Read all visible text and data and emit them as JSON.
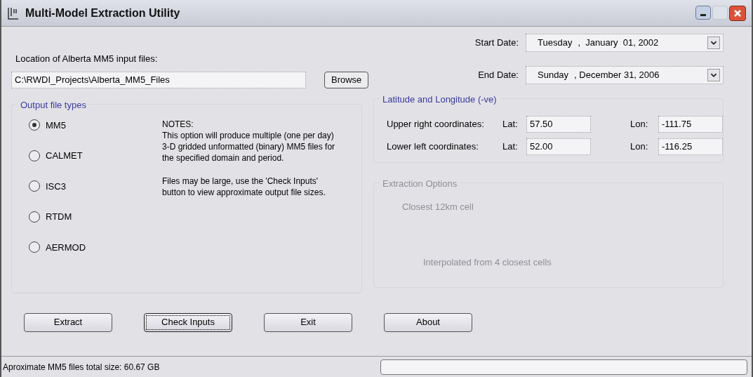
{
  "window": {
    "title": "Multi-Model Extraction Utility"
  },
  "input_location": {
    "label": "Location of Alberta MM5 input files:",
    "value": "C:\\RWDI_Projects\\Alberta_MM5_Files",
    "browse_button": "Browse"
  },
  "dates": [
    {
      "label": "Start Date:",
      "weekday": "Tuesday",
      "date": ",  January  01, 2002"
    },
    {
      "label": "End Date:",
      "weekday": "Sunday",
      "date": ", December 31, 2006"
    }
  ],
  "output_file_types": {
    "title": "Output file types",
    "options": [
      {
        "label": "MM5",
        "selected": true
      },
      {
        "label": "CALMET",
        "selected": false
      },
      {
        "label": "ISC3",
        "selected": false
      },
      {
        "label": "RTDM",
        "selected": false
      },
      {
        "label": "AERMOD",
        "selected": false
      }
    ],
    "notes": [
      "NOTES:\nThis option will produce multiple (one per day) 3-D gridded unformatted (binary) MM5 files for the specified domain and period.",
      "Files may be large, use the 'Check Inputs' button to view approximate output file sizes."
    ]
  },
  "coordinates": {
    "title": "Latitude and Longitude (-ve)",
    "rows": [
      {
        "label": "Upper right coordinates:",
        "lat_label": "Lat:",
        "lat": "57.50",
        "lon_label": "Lon:",
        "lon": "-111.75"
      },
      {
        "label": "Lower left coordinates:",
        "lat_label": "Lat:",
        "lat": "52.00",
        "lon_label": "Lon:",
        "lon": "-116.25"
      }
    ]
  },
  "extraction_options": {
    "title": "Extraction Options",
    "disabled": true,
    "options": [
      "Closest 12km cell",
      "Interpolated from 4 closest cells"
    ]
  },
  "buttons": [
    {
      "label": "Extract",
      "focused": false
    },
    {
      "label": "Check Inputs",
      "focused": true
    },
    {
      "label": "Exit",
      "focused": false
    },
    {
      "label": "About",
      "focused": false
    }
  ],
  "status_bar": {
    "text": "Aproximate MM5 files total size: 60.67 GB",
    "progress": {
      "level": 0
    }
  }
}
